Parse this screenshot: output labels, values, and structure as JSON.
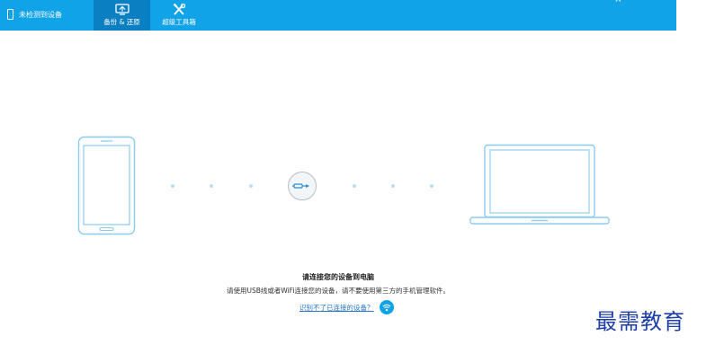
{
  "header": {
    "device_status": "未检测到设备",
    "tabs": [
      {
        "label": "备份 & 还原",
        "active": true
      },
      {
        "label": "超级工具箱",
        "active": false
      }
    ],
    "window_controls": "— ×"
  },
  "connection": {
    "title": "请连接您的设备到电脑",
    "description": "请使用USB线或者WiFi连接您的设备，请不要使用第三方的手机管理软件。",
    "help_link": "识别不了已连接的设备？"
  },
  "watermark": "最需教育",
  "colors": {
    "header_bg": "#11a3e8",
    "active_tab_bg": "#0a7fc2",
    "illustration_line": "#8ccbf0",
    "link": "#2778c8"
  },
  "icons": {
    "device": "phone-outline-icon",
    "backup": "backup-restore-icon",
    "toolbox": "tools-icon",
    "phone": "smartphone-illustration",
    "laptop": "laptop-illustration",
    "cable": "usb-plug-icon",
    "wifi": "wifi-icon"
  }
}
